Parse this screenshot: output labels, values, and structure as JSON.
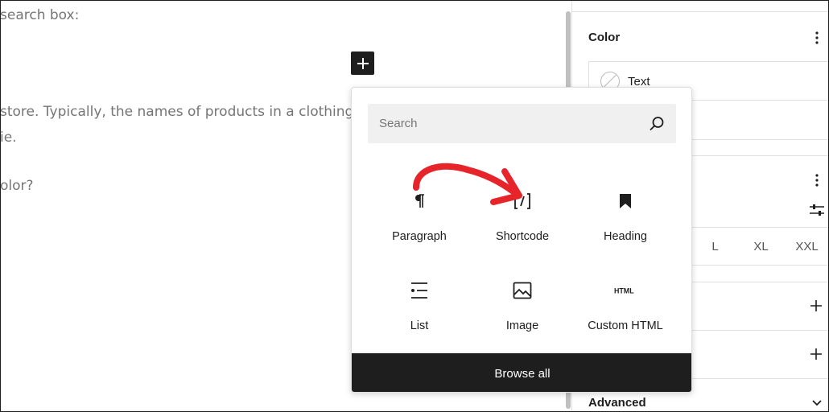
{
  "editor": {
    "lines": [
      " search box:",
      "store. Typically, the names of products in a clothing sto",
      "ie.",
      "olor?"
    ]
  },
  "sidebar": {
    "color_title": "Color",
    "color_text_label": "Text",
    "sizes": [
      "L",
      "XL",
      "XXL"
    ],
    "advanced": "Advanced"
  },
  "inserter": {
    "search_placeholder": "Search",
    "blocks": [
      {
        "label": "Paragraph",
        "icon": "paragraph-icon"
      },
      {
        "label": "Shortcode",
        "icon": "shortcode-icon"
      },
      {
        "label": "Heading",
        "icon": "bookmark-icon"
      },
      {
        "label": "List",
        "icon": "list-icon"
      },
      {
        "label": "Image",
        "icon": "image-icon"
      },
      {
        "label": "Custom HTML",
        "icon": "html-icon"
      }
    ],
    "browse_all": "Browse all",
    "annotation_color": "#e8242b"
  }
}
